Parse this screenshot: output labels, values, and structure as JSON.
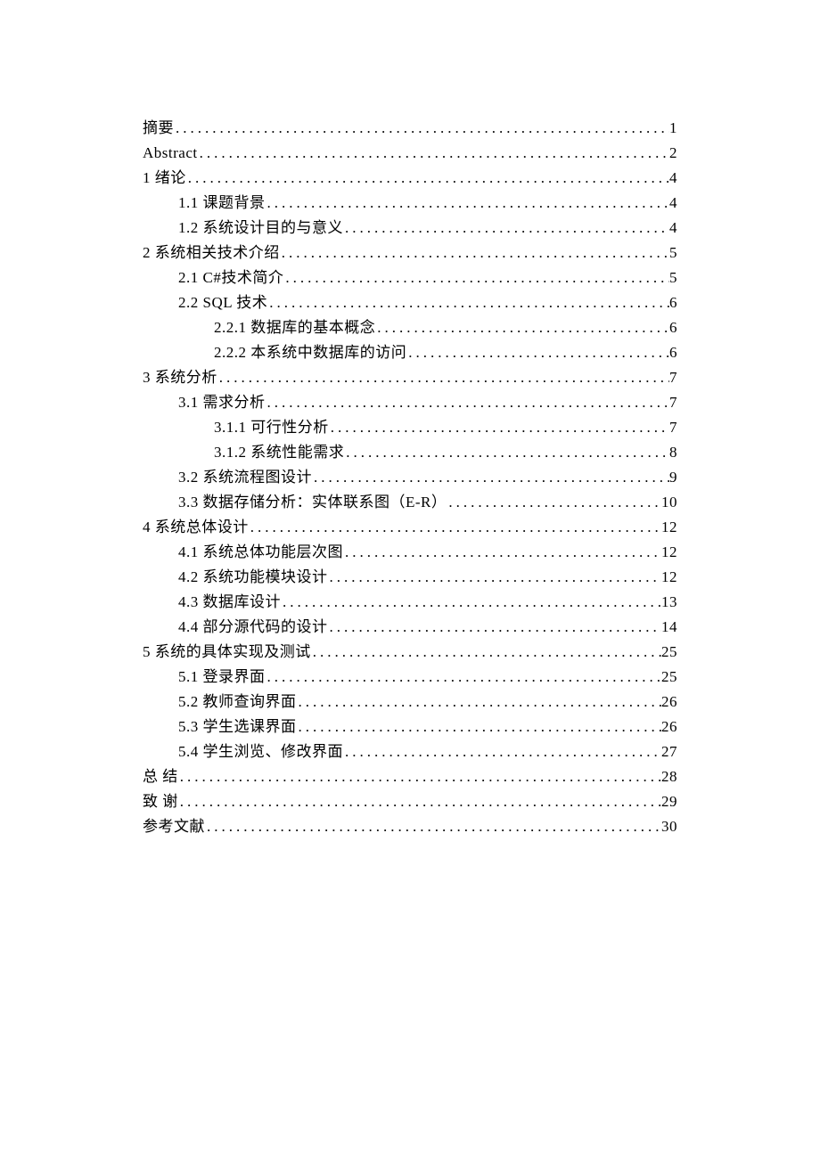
{
  "toc": [
    {
      "level": 0,
      "title": "摘要",
      "page": "1"
    },
    {
      "level": 0,
      "title": "Abstract",
      "page": "2"
    },
    {
      "level": 0,
      "title": "1 绪论",
      "page": "4"
    },
    {
      "level": 1,
      "title": "1.1 课题背景",
      "page": "4"
    },
    {
      "level": 1,
      "title": "1.2 系统设计目的与意义",
      "page": "4"
    },
    {
      "level": 0,
      "title": "2 系统相关技术介绍",
      "page": "5"
    },
    {
      "level": 1,
      "title": "2.1 C#技术简介",
      "page": "5"
    },
    {
      "level": 1,
      "title": "2.2 SQL 技术",
      "page": "6"
    },
    {
      "level": 2,
      "title": "2.2.1 数据库的基本概念",
      "page": "6"
    },
    {
      "level": 2,
      "title": "2.2.2 本系统中数据库的访问",
      "page": "6"
    },
    {
      "level": 0,
      "title": "3 系统分析",
      "page": "7"
    },
    {
      "level": 1,
      "title": "3.1 需求分析",
      "page": "7"
    },
    {
      "level": 2,
      "title": "3.1.1 可行性分析",
      "page": "7"
    },
    {
      "level": 2,
      "title": "3.1.2 系统性能需求",
      "page": "8"
    },
    {
      "level": 1,
      "title": "3.2 系统流程图设计",
      "page": "9"
    },
    {
      "level": 1,
      "title": "3.3 数据存储分析：实体联系图（E-R）",
      "page": "10"
    },
    {
      "level": 0,
      "title": "4 系统总体设计",
      "page": "12"
    },
    {
      "level": 1,
      "title": "4.1 系统总体功能层次图",
      "page": "12"
    },
    {
      "level": 1,
      "title": "4.2 系统功能模块设计",
      "page": "12"
    },
    {
      "level": 1,
      "title": "4.3 数据库设计",
      "page": "13"
    },
    {
      "level": 1,
      "title": "4.4 部分源代码的设计",
      "page": "14"
    },
    {
      "level": 0,
      "title": "5 系统的具体实现及测试",
      "page": "25"
    },
    {
      "level": 1,
      "title": "5.1 登录界面",
      "page": "25"
    },
    {
      "level": 1,
      "title": "5.2 教师查询界面",
      "page": "26"
    },
    {
      "level": 1,
      "title": "5.3 学生选课界面",
      "page": "26"
    },
    {
      "level": 1,
      "title": "5.4 学生浏览、修改界面",
      "page": "27"
    },
    {
      "level": 0,
      "title": "总 结",
      "page": "28"
    },
    {
      "level": 0,
      "title": "致 谢",
      "page": "29"
    },
    {
      "level": 0,
      "title": "参考文献",
      "page": "30"
    }
  ]
}
